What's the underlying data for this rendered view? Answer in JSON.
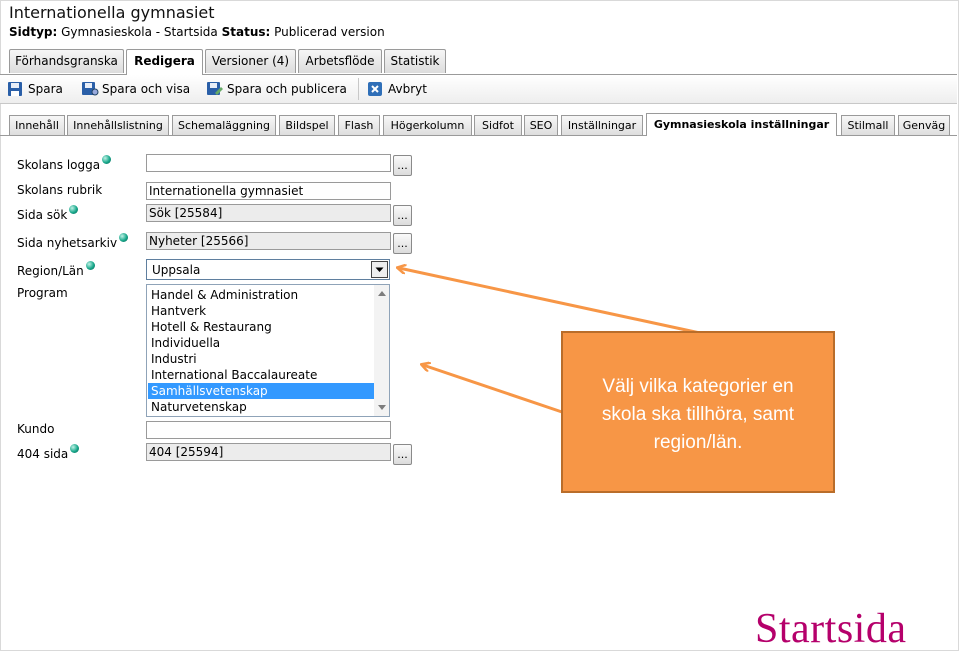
{
  "header": {
    "title": "Internationella gymnasiet",
    "sidtyp_label": "Sidtyp:",
    "sidtyp_value": "Gymnasieskola - Startsida",
    "status_label": "Status:",
    "status_value": "Publicerad version"
  },
  "main_tabs": [
    "Förhandsgranska",
    "Redigera",
    "Versioner (4)",
    "Arbetsflöde",
    "Statistik"
  ],
  "main_tab_active": "Redigera",
  "toolbar": {
    "save": "Spara",
    "save_view": "Spara och visa",
    "save_publish": "Spara och publicera",
    "cancel": "Avbryt"
  },
  "sub_tabs": [
    "Innehåll",
    "Innehållslistning",
    "Schemaläggning",
    "Bildspel",
    "Flash",
    "Högerkolumn",
    "Sidfot",
    "SEO",
    "Inställningar",
    "Gymnasieskola inställningar",
    "Stilmall",
    "Genväg"
  ],
  "sub_tab_active": "Gymnasieskola inställningar",
  "form": {
    "logo_label": "Skolans logga",
    "logo_value": "",
    "title_label": "Skolans rubrik",
    "title_value": "Internationella gymnasiet",
    "search_label": "Sida sök",
    "search_value": "Sök [25584]",
    "news_label": "Sida nyhetsarkiv",
    "news_value": "Nyheter [25566]",
    "region_label": "Region/Län",
    "region_value": "Uppsala",
    "program_label": "Program",
    "program_options": [
      "Handel & Administration",
      "Hantverk",
      "Hotell & Restaurang",
      "Individuella",
      "Industri",
      "International Baccalaureate",
      "Samhällsvetenskap",
      "Naturvetenskap"
    ],
    "program_selected": "Samhällsvetenskap",
    "kundo_label": "Kundo",
    "kundo_value": "",
    "notfound_label": "404 sida",
    "notfound_value": "404 [25594]",
    "browse_label": "..."
  },
  "callout": {
    "lines": [
      "Välj vilka kategorier en",
      "skola ska tillhöra, samt",
      "region/län."
    ]
  },
  "brand": "Startsida",
  "colors": {
    "callout_fill": "#f79646",
    "arrow": "#f79646",
    "brand": "#b5006b",
    "selected_option": "#3399ff"
  }
}
